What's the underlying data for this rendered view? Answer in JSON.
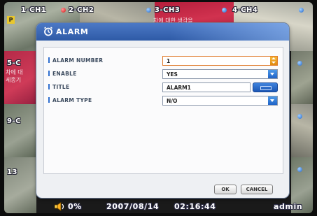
{
  "channels": [
    {
      "label": "1-CH1",
      "marker": "P",
      "status": "red"
    },
    {
      "label": "2-CH2",
      "status": "blue"
    },
    {
      "label": "3-CH3",
      "subtitle": "차에 대한 생각을",
      "status": "blue"
    },
    {
      "label": "4-CH4",
      "status": "blue"
    },
    {
      "label": "5-C",
      "subtitle_lines": [
        "차에 대",
        "세종기"
      ]
    },
    {
      "label": "9-C"
    },
    {
      "label": "13"
    }
  ],
  "dialog": {
    "title": "ALARM",
    "fields": {
      "alarm_number": {
        "label": "ALARM NUMBER",
        "value": "1"
      },
      "enable": {
        "label": "ENABLE",
        "value": "YES"
      },
      "title": {
        "label": "TITLE",
        "value": "ALARM1"
      },
      "alarm_type": {
        "label": "ALARM TYPE",
        "value": "N/O"
      }
    },
    "buttons": {
      "ok": "OK",
      "cancel": "CANCEL"
    }
  },
  "statusbar": {
    "volume": "0%",
    "date": "2007/08/14",
    "time": "02:16:44",
    "user": "admin"
  },
  "colors": {
    "accent": "#2f6fd0",
    "highlight": "#e07a2a",
    "title_bar": "#3a67b6"
  }
}
